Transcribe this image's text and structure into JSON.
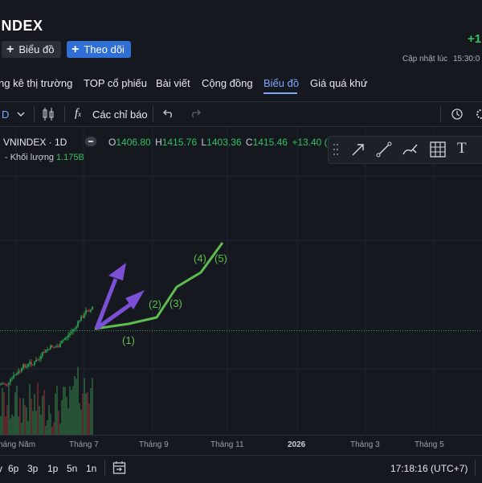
{
  "header": {
    "title": "INDEX",
    "chart_button_label": "Biểu đồ",
    "follow_button_label": "Theo dõi",
    "change": "+1",
    "updated_label": "Cập nhật lúc",
    "updated_time": "15:30:0"
  },
  "nav_tabs": [
    "ng kê thị trường",
    "TOP cổ phiếu",
    "Bài viết",
    "Cộng đồng",
    "Biểu đồ",
    "Giá quá khứ"
  ],
  "active_tab": "Biểu đồ",
  "toolbar": {
    "interval": "D",
    "indicators_label": "Các chỉ báo"
  },
  "legend": {
    "symbol": "VNINDEX · 1D",
    "o_label": "O",
    "o_value": "1406.80",
    "h_label": "H",
    "h_value": "1415.76",
    "l_label": "L",
    "l_value": "1403.36",
    "c_label": "C",
    "c_value": "1415.46",
    "change": "+13.40 (+0",
    "volume_label": "- Khối lượng",
    "volume_value": "1.175B"
  },
  "annotations": [
    "(1)",
    "(2)",
    "(3)",
    "(4)",
    "(5)"
  ],
  "x_axis": [
    "háng Năm",
    "Tháng 7",
    "Tháng 9",
    "Tháng 11",
    "2026",
    "Tháng 3",
    "Tháng 5"
  ],
  "bottom_bar": {
    "ranges": [
      "y",
      "6p",
      "3p",
      "1p",
      "5n",
      "1n"
    ],
    "clock": "17:18:16 (UTC+7)"
  },
  "colors": {
    "background": "#15181f",
    "accent": "#2f6fd6",
    "up": "#33c15e",
    "down": "#e0464d",
    "wave": "#5fbd4f",
    "arrow": "#7b4fd6"
  }
}
